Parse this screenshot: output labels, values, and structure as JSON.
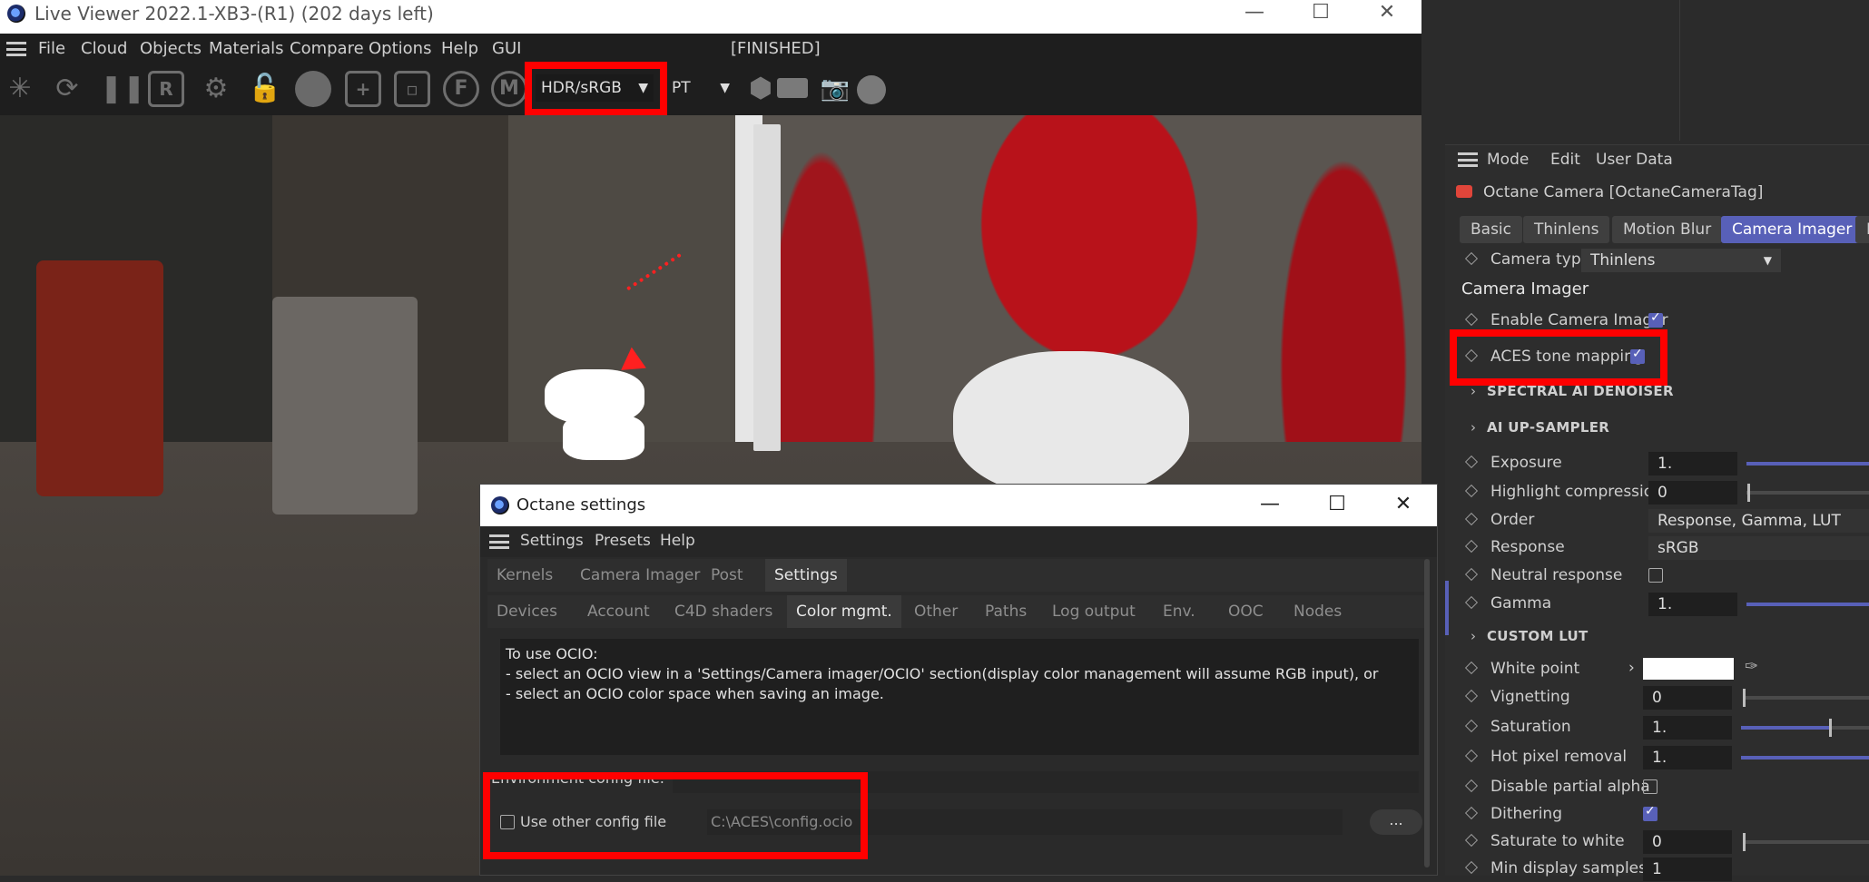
{
  "live_viewer": {
    "title": "Live Viewer 2022.1-XB3-(R1) (202 days left)",
    "menu": [
      "File",
      "Cloud",
      "Objects",
      "Materials",
      "Compare",
      "Options",
      "Help",
      "GUI"
    ],
    "status": "[FINISHED]",
    "toolbar_letters": {
      "r": "R",
      "f": "F",
      "m": "M"
    },
    "color_mode": "HDR/sRGB",
    "kernel_mode": "PT"
  },
  "octane_settings": {
    "title": "Octane settings",
    "menu": [
      "Settings",
      "Presets",
      "Help"
    ],
    "tabs_main": [
      "Kernels",
      "Camera Imager",
      "Post",
      "Settings"
    ],
    "tabs_sub": [
      "Devices",
      "Account",
      "C4D shaders",
      "Color mgmt.",
      "Other",
      "Paths",
      "Log output",
      "Env.",
      "OOC",
      "Nodes"
    ],
    "info_lines": [
      "To use OCIO:",
      "- select an OCIO view in a 'Settings/Camera imager/OCIO' section(display color management will assume RGB input), or",
      "- select an OCIO color space when saving an image."
    ],
    "env_label": "Environment config file:",
    "use_other_label": "Use other config file",
    "config_path": "C:\\ACES\\config.ocio",
    "browse_label": "..."
  },
  "attributes": {
    "menu": [
      "Mode",
      "Edit",
      "User Data"
    ],
    "object_title": "Octane Camera [OctaneCameraTag]",
    "tabs": [
      "Basic",
      "Thinlens",
      "Motion Blur",
      "Camera Imager",
      "P"
    ],
    "camera_type_label": "Camera type",
    "camera_type_value": "Thinlens",
    "section_header": "Camera Imager",
    "enable_imager_label": "Enable Camera Imager",
    "aces_label": "ACES tone mapping",
    "spectral_denoiser": "SPECTRAL AI DENOISER",
    "upsampler": "AI UP-SAMPLER",
    "exposure_label": "Exposure",
    "exposure_value": "1.",
    "highlight_label": "Highlight compression",
    "highlight_value": "0",
    "order_label": "Order",
    "order_value": "Response, Gamma, LUT",
    "response_label": "Response",
    "response_value": "sRGB",
    "neutral_label": "Neutral response",
    "gamma_label": "Gamma",
    "gamma_value": "1.",
    "custom_lut": "CUSTOM LUT",
    "white_point_label": "White point",
    "vignetting_label": "Vignetting",
    "vignetting_value": "0",
    "saturation_label": "Saturation",
    "saturation_value": "1.",
    "hot_pixel_label": "Hot pixel removal",
    "hot_pixel_value": "1.",
    "disable_alpha_label": "Disable partial alpha",
    "dithering_label": "Dithering",
    "saturate_white_label": "Saturate to white",
    "saturate_white_value": "0",
    "min_display_label": "Min display samples",
    "min_display_value": "1"
  },
  "colors": {
    "accent": "#5860b8",
    "highlight_box": "#ff0000"
  }
}
